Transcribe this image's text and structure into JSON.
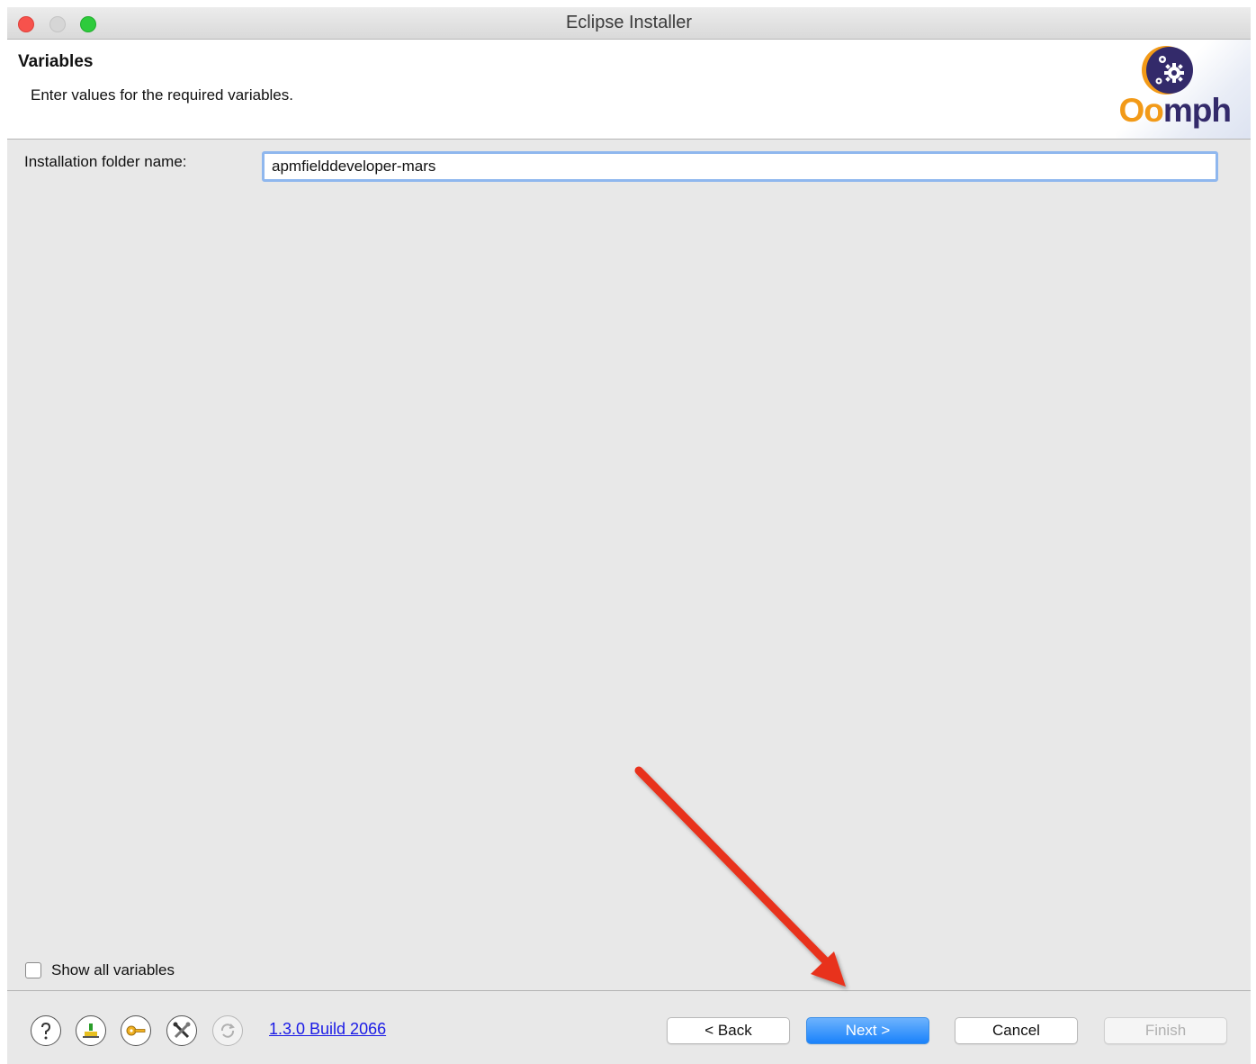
{
  "window": {
    "title": "Eclipse Installer"
  },
  "header": {
    "title": "Variables",
    "description": "Enter values for the required variables.",
    "logo_text_o": "Oo",
    "logo_text_rest": "mph"
  },
  "form": {
    "fields": [
      {
        "label": "Installation folder name:",
        "value": "apmfielddeveloper-mars"
      }
    ]
  },
  "options": {
    "show_all_variables_label": "Show all variables",
    "show_all_variables_checked": false
  },
  "footer": {
    "icons": [
      "help-icon",
      "bundle-pool-icon",
      "key-icon",
      "tools-icon",
      "update-icon"
    ],
    "version_link": "1.3.0 Build 2066",
    "buttons": {
      "back": "< Back",
      "next": "Next >",
      "cancel": "Cancel",
      "finish": "Finish"
    }
  },
  "colors": {
    "accent_blue": "#1a82fb",
    "input_focus": "#8fb7ee",
    "annotation_arrow": "#e8301c",
    "logo_orange": "#f29a18",
    "logo_purple": "#332a6a"
  }
}
